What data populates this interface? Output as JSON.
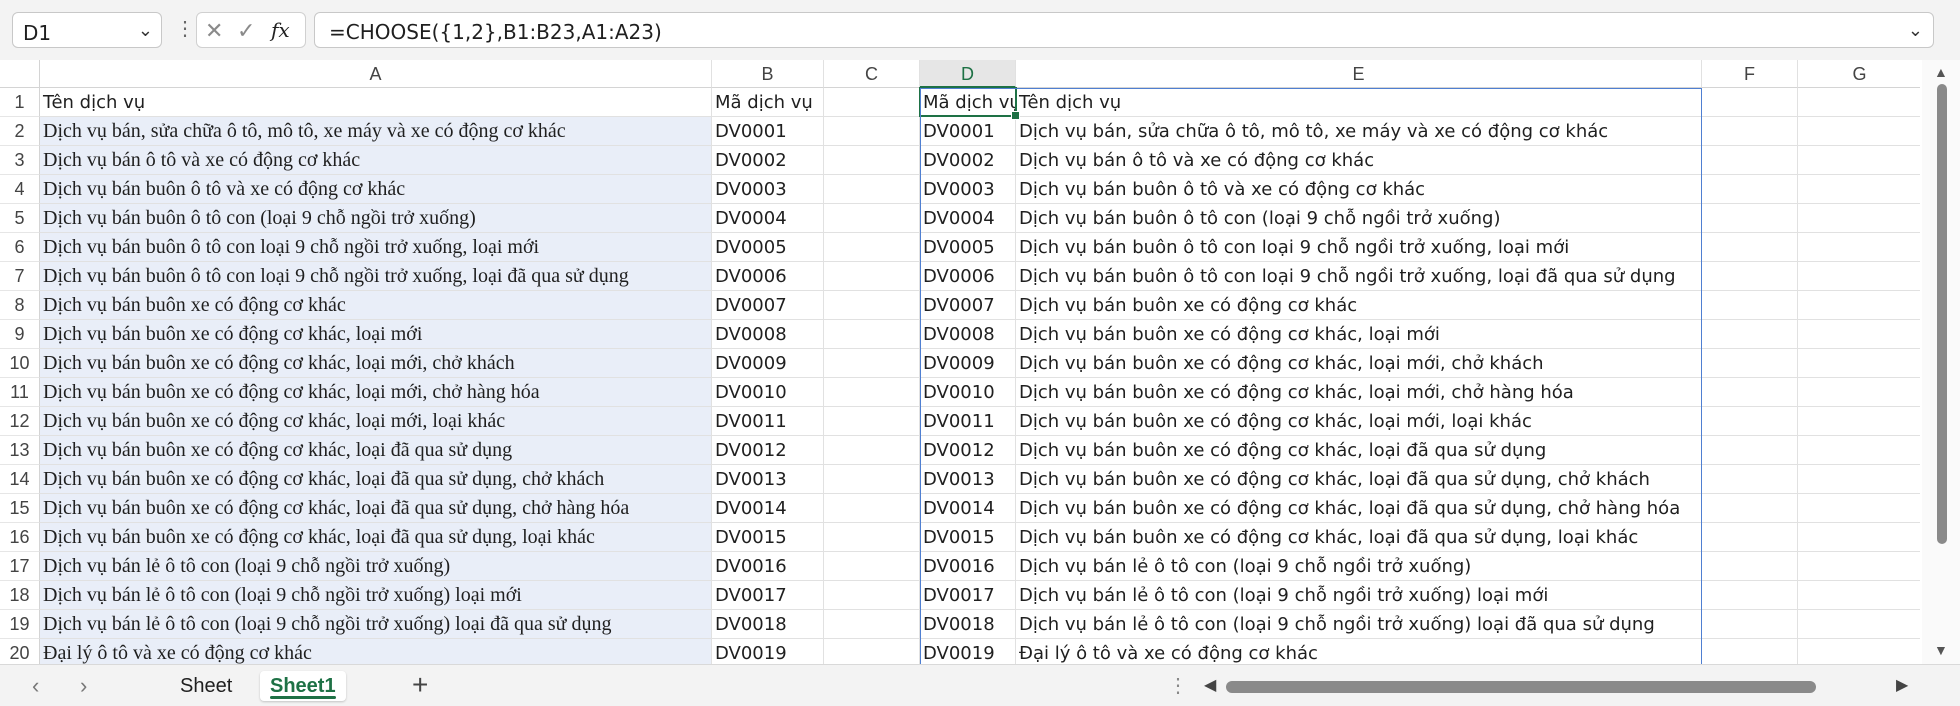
{
  "namebox": {
    "value": "D1"
  },
  "formula_bar": {
    "formula": "=CHOOSE({1,2},B1:B23,A1:A23)",
    "fx_label": "fx"
  },
  "columns": [
    "A",
    "B",
    "C",
    "D",
    "E",
    "F",
    "G"
  ],
  "rows": [
    {
      "num": "1",
      "a": "Tên dịch vụ",
      "b": "Mã dịch vụ",
      "d": "Mã dịch vụ",
      "e": "Tên dịch vụ"
    },
    {
      "num": "2",
      "a": "Dịch vụ bán, sửa chữa ô tô, mô tô, xe máy và xe có động cơ khác",
      "b": "DV0001",
      "d": "DV0001",
      "e": "Dịch vụ bán, sửa chữa ô tô, mô tô, xe máy và xe có động cơ khác"
    },
    {
      "num": "3",
      "a": "Dịch vụ bán ô tô và xe có động cơ khác",
      "b": "DV0002",
      "d": "DV0002",
      "e": "Dịch vụ bán ô tô và xe có động cơ khác"
    },
    {
      "num": "4",
      "a": "Dịch vụ bán buôn ô tô và xe có động cơ khác",
      "b": "DV0003",
      "d": "DV0003",
      "e": "Dịch vụ bán buôn ô tô và xe có động cơ khác"
    },
    {
      "num": "5",
      "a": "Dịch vụ bán buôn ô tô con (loại 9 chỗ ngồi trở xuống)",
      "b": "DV0004",
      "d": "DV0004",
      "e": "Dịch vụ bán buôn ô tô con (loại 9 chỗ ngồi trở xuống)"
    },
    {
      "num": "6",
      "a": "Dịch vụ bán buôn ô tô con loại 9 chỗ ngồi trở xuống, loại mới",
      "b": "DV0005",
      "d": "DV0005",
      "e": "Dịch vụ bán buôn ô tô con loại 9 chỗ ngồi trở xuống, loại mới"
    },
    {
      "num": "7",
      "a": "Dịch vụ bán buôn ô tô con loại 9 chỗ ngồi trở xuống, loại đã qua sử dụng",
      "b": "DV0006",
      "d": "DV0006",
      "e": "Dịch vụ bán buôn ô tô con loại 9 chỗ ngồi trở xuống, loại đã qua sử dụng"
    },
    {
      "num": "8",
      "a": "Dịch vụ bán buôn xe có động cơ khác",
      "b": "DV0007",
      "d": "DV0007",
      "e": "Dịch vụ bán buôn xe có động cơ khác"
    },
    {
      "num": "9",
      "a": "Dịch vụ bán buôn xe có động cơ khác, loại mới",
      "b": "DV0008",
      "d": "DV0008",
      "e": "Dịch vụ bán buôn xe có động cơ khác, loại mới"
    },
    {
      "num": "10",
      "a": "Dịch vụ bán buôn xe có động cơ khác, loại mới, chở khách",
      "b": "DV0009",
      "d": "DV0009",
      "e": "Dịch vụ bán buôn xe có động cơ khác, loại mới, chở khách"
    },
    {
      "num": "11",
      "a": "Dịch vụ bán buôn xe có động cơ khác, loại mới, chở hàng hóa",
      "b": "DV0010",
      "d": "DV0010",
      "e": "Dịch vụ bán buôn xe có động cơ khác, loại mới, chở hàng hóa"
    },
    {
      "num": "12",
      "a": "Dịch vụ bán buôn xe có động cơ khác, loại mới, loại khác",
      "b": "DV0011",
      "d": "DV0011",
      "e": "Dịch vụ bán buôn xe có động cơ khác, loại mới, loại khác"
    },
    {
      "num": "13",
      "a": "Dịch vụ bán buôn xe có động cơ khác, loại đã qua sử dụng",
      "b": "DV0012",
      "d": "DV0012",
      "e": "Dịch vụ bán buôn xe có động cơ khác, loại đã qua sử dụng"
    },
    {
      "num": "14",
      "a": "Dịch vụ bán buôn xe có động cơ khác, loại đã qua sử dụng, chở khách",
      "b": "DV0013",
      "d": "DV0013",
      "e": "Dịch vụ bán buôn xe có động cơ khác, loại đã qua sử dụng, chở khách"
    },
    {
      "num": "15",
      "a": "Dịch vụ bán buôn xe có động cơ khác, loại đã qua sử dụng, chở hàng hóa",
      "b": "DV0014",
      "d": "DV0014",
      "e": "Dịch vụ bán buôn xe có động cơ khác, loại đã qua sử dụng, chở hàng hóa"
    },
    {
      "num": "16",
      "a": "Dịch vụ bán buôn xe có động cơ khác, loại đã qua sử dụng, loại khác",
      "b": "DV0015",
      "d": "DV0015",
      "e": "Dịch vụ bán buôn xe có động cơ khác, loại đã qua sử dụng, loại khác"
    },
    {
      "num": "17",
      "a": "Dịch vụ bán lẻ ô tô con (loại 9 chỗ ngồi trở xuống)",
      "b": "DV0016",
      "d": "DV0016",
      "e": "Dịch vụ bán lẻ ô tô con (loại 9 chỗ ngồi trở xuống)"
    },
    {
      "num": "18",
      "a": "Dịch vụ bán lẻ ô tô con (loại 9 chỗ ngồi trở xuống) loại mới",
      "b": "DV0017",
      "d": "DV0017",
      "e": "Dịch vụ bán lẻ ô tô con (loại 9 chỗ ngồi trở xuống) loại mới"
    },
    {
      "num": "19",
      "a": "Dịch vụ bán lẻ ô tô con (loại 9 chỗ ngồi trở xuống) loại đã qua sử dụng",
      "b": "DV0018",
      "d": "DV0018",
      "e": "Dịch vụ bán lẻ ô tô con (loại 9 chỗ ngồi trở xuống) loại đã qua sử dụng"
    },
    {
      "num": "20",
      "a": "Đại lý ô tô và xe có động cơ khác",
      "b": "DV0019",
      "d": "DV0019",
      "e": "Đại lý ô tô và xe có động cơ khác"
    }
  ],
  "sheets": [
    {
      "name": "Sheet",
      "active": false
    },
    {
      "name": "Sheet1",
      "active": true
    }
  ],
  "colors": {
    "accent": "#1e7145",
    "shaded": "#e9eef8",
    "spill_border": "#4f7fd1"
  }
}
